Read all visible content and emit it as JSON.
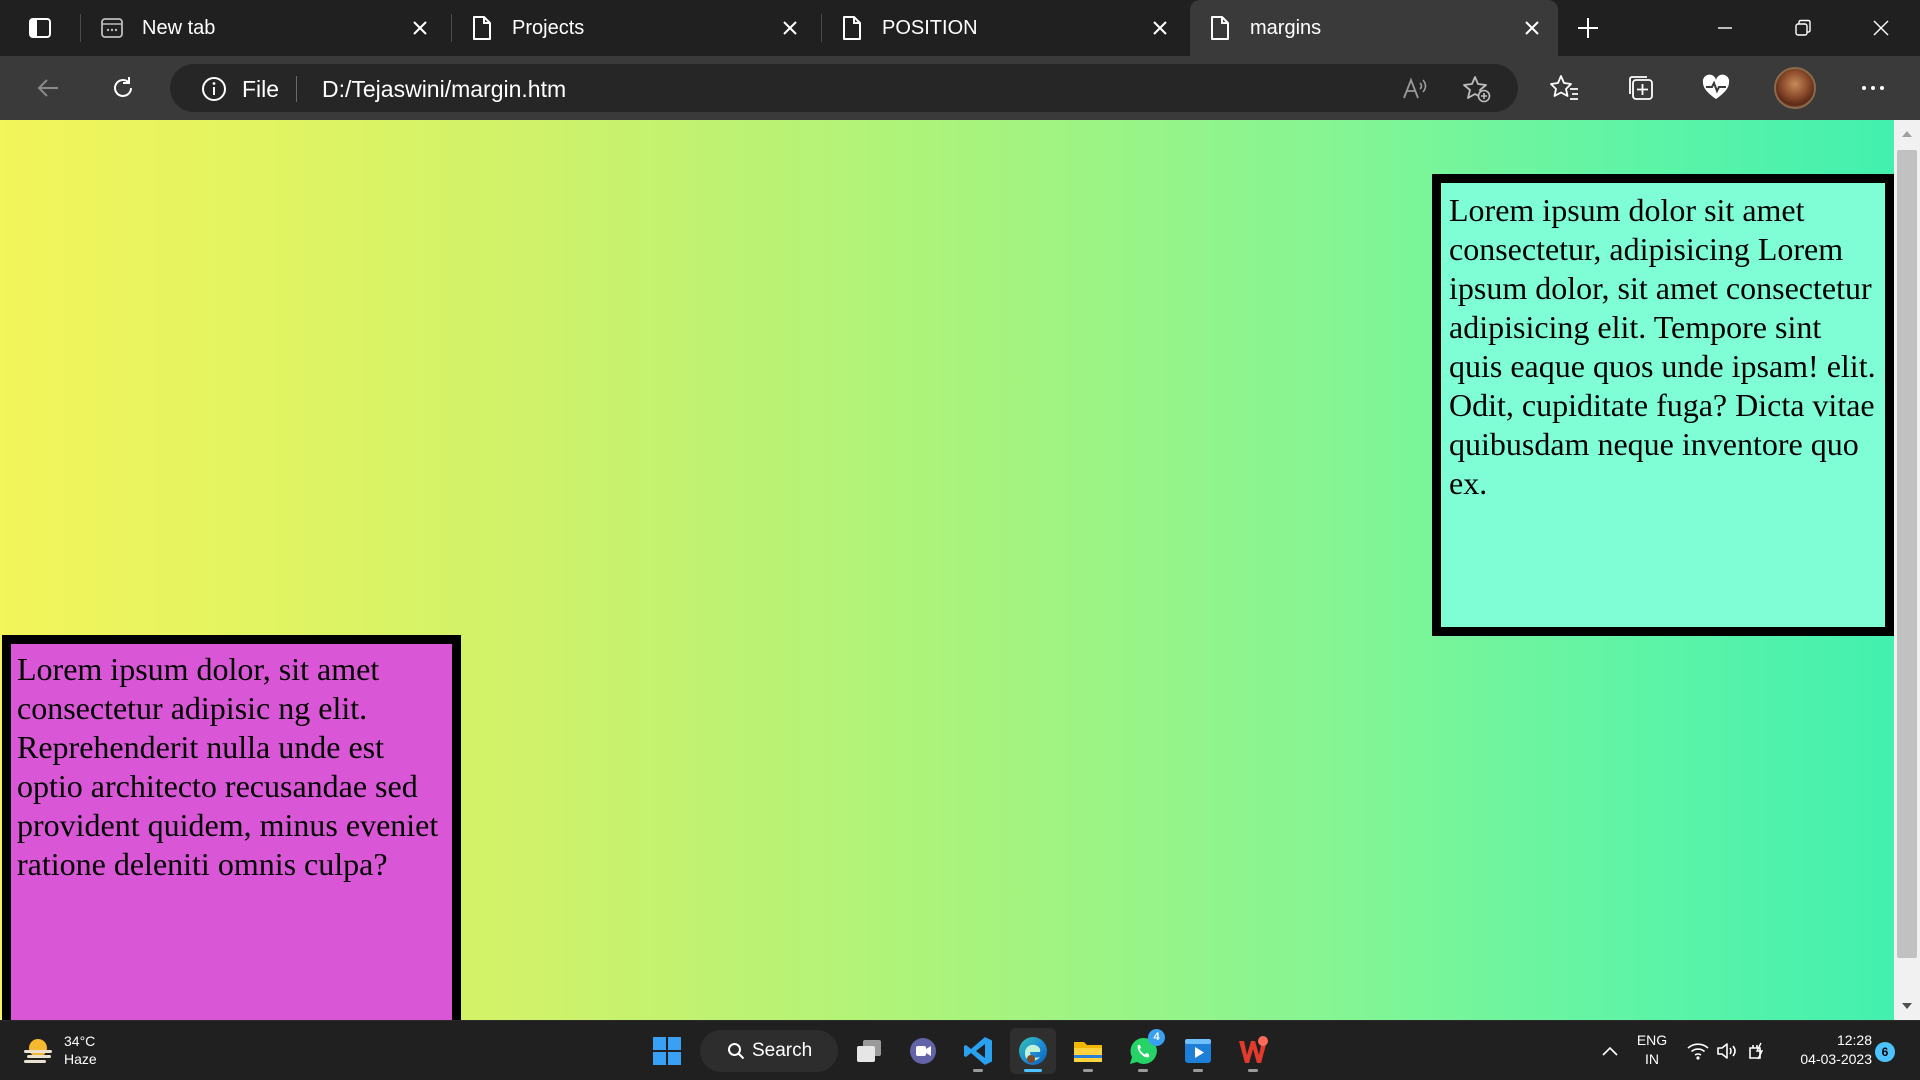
{
  "browser": {
    "tabs": [
      {
        "title": "New tab",
        "icon": "new-tab-page-icon",
        "active": false
      },
      {
        "title": "Projects",
        "icon": "document-icon",
        "active": false
      },
      {
        "title": "POSITION",
        "icon": "document-icon",
        "active": false
      },
      {
        "title": "margins",
        "icon": "document-icon",
        "active": true
      }
    ],
    "address_bar": {
      "scheme_label": "File",
      "url": "D:/Tejaswini/margin.htm"
    }
  },
  "page": {
    "box_right_text": "Lorem ipsum dolor sit amet consectetur, adipisicing Lorem ipsum dolor, sit amet consectetur adipisicing elit. Tempore sint quis eaque quos unde ipsam! elit. Odit, cupiditate fuga? Dicta vitae quibusdam neque inventore quo ex.",
    "box_left_text": "Lorem ipsum dolor, sit amet consectetur adipisic ng elit. Reprehenderit nulla unde est optio architecto recusandae sed provident quidem, minus eveniet ratione deleniti omnis culpa?",
    "colors": {
      "gradient_start": "#f3f55a",
      "gradient_end": "#40f0b0",
      "box_right_bg": "#7ffed6",
      "box_left_bg": "#d957d7",
      "border": "#000000"
    }
  },
  "taskbar": {
    "weather": {
      "temp": "34°C",
      "desc": "Haze"
    },
    "search_label": "Search",
    "apps": [
      {
        "name": "start-icon"
      },
      {
        "name": "task-view-icon"
      },
      {
        "name": "teams-chat-icon"
      },
      {
        "name": "vscode-icon"
      },
      {
        "name": "edge-icon",
        "active": true
      },
      {
        "name": "file-explorer-icon"
      },
      {
        "name": "whatsapp-icon",
        "badge": "4"
      },
      {
        "name": "media-player-icon"
      },
      {
        "name": "wps-office-icon"
      }
    ],
    "language": {
      "line1": "ENG",
      "line2": "IN"
    },
    "clock": {
      "time": "12:28",
      "date": "04-03-2023"
    },
    "notification_count": "6"
  }
}
